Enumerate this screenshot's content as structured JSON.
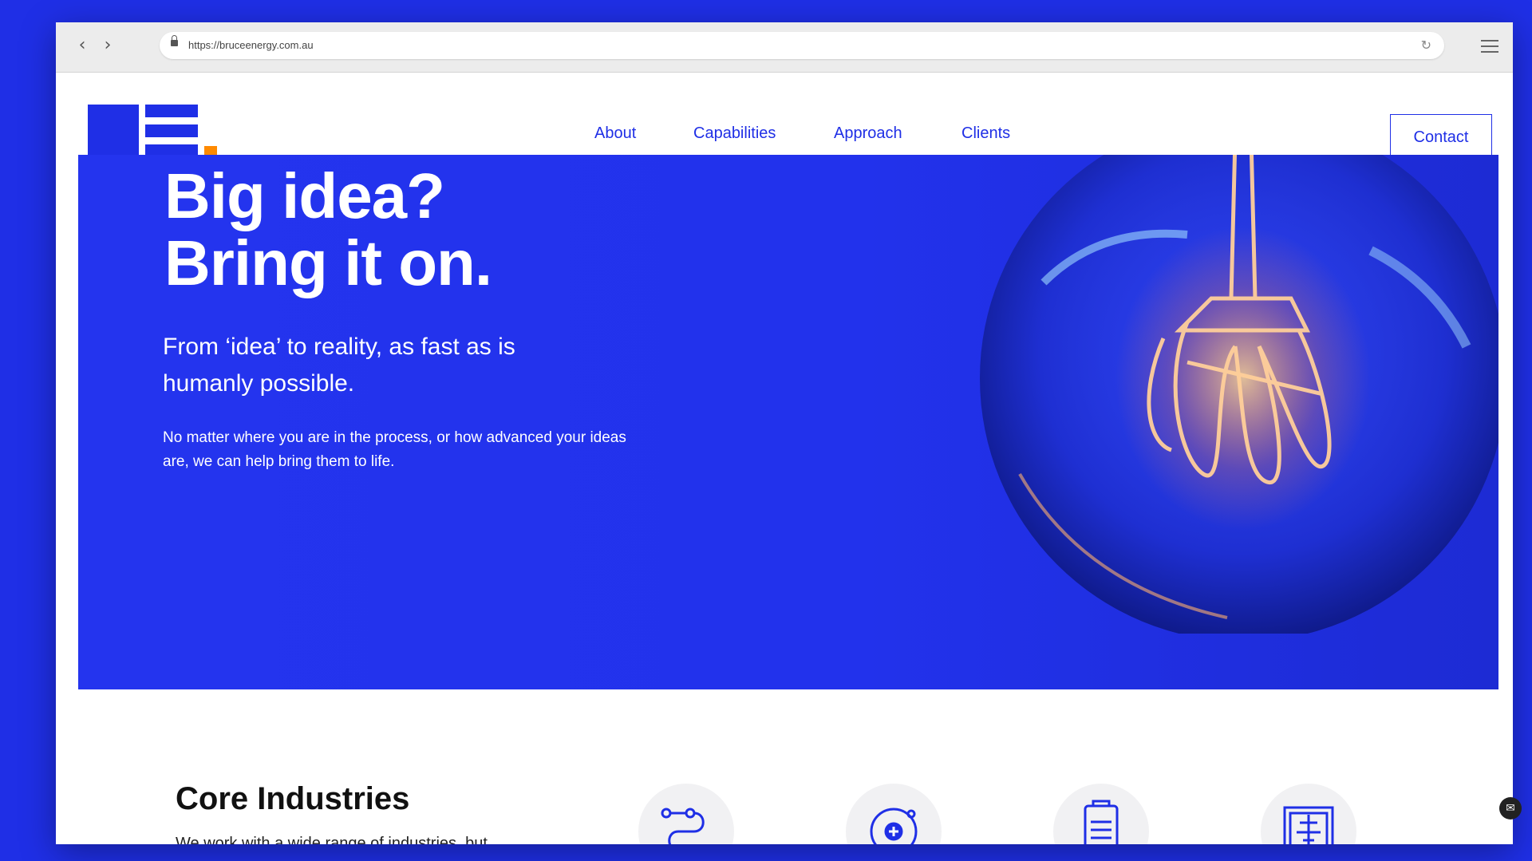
{
  "browser": {
    "url": "https://bruceenergy.com.au",
    "back_glyph": "‹",
    "forward_glyph": "›",
    "reload_glyph": "↻"
  },
  "header": {
    "nav": [
      {
        "label": "About"
      },
      {
        "label": "Capabilities"
      },
      {
        "label": "Approach"
      },
      {
        "label": "Clients"
      }
    ],
    "contact_label": "Contact"
  },
  "hero": {
    "title_line1": "Big idea?",
    "title_line2": "Bring it on.",
    "subtitle": "From ‘idea’ to reality, as fast as is humanly possible.",
    "body": "No matter where you are in the process, or how advanced your ideas are, we can help bring them to life."
  },
  "industries": {
    "title": "Core Industries",
    "text": "We work with a wide range of industries, but",
    "icons": [
      "flow-icon",
      "target-plus-icon",
      "battery-icon",
      "circuit-icon"
    ]
  },
  "colors": {
    "brand_blue": "#1f2fe6",
    "accent_orange": "#ff8a00",
    "white": "#ffffff"
  }
}
